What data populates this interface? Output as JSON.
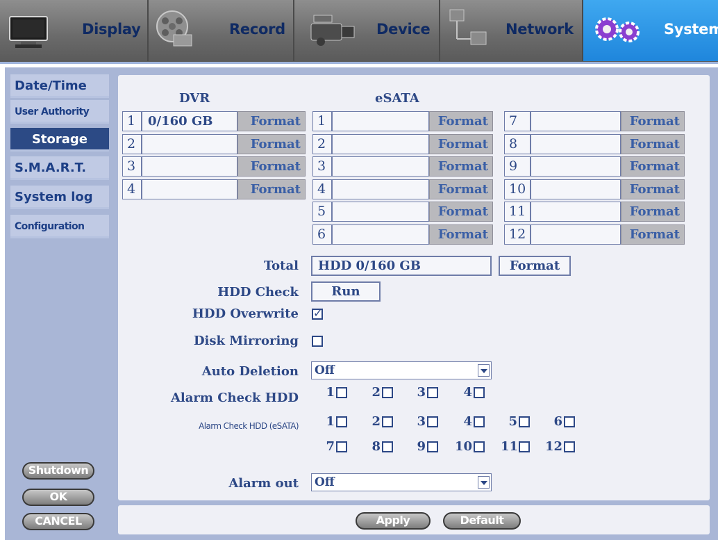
{
  "tabs": [
    {
      "label": "Display",
      "icon": "monitor-icon"
    },
    {
      "label": "Record",
      "icon": "film-reel-icon"
    },
    {
      "label": "Device",
      "icon": "camcorder-icon"
    },
    {
      "label": "Network",
      "icon": "network-icon"
    },
    {
      "label": "System",
      "icon": "gears-icon",
      "active": true
    }
  ],
  "sidebar": {
    "items": [
      {
        "label": "Date/Time"
      },
      {
        "label": "User Authority"
      },
      {
        "label": "Storage",
        "selected": true
      },
      {
        "label": "S.M.A.R.T."
      },
      {
        "label": "System log"
      },
      {
        "label": "Configuration"
      }
    ],
    "shutdown": "Shutdown",
    "ok": "OK",
    "cancel": "CANCEL"
  },
  "storage": {
    "dvr_header": "DVR",
    "esata_header": "eSATA",
    "format_label": "Format",
    "dvr": [
      {
        "num": "1",
        "value": "0/160 GB"
      },
      {
        "num": "2",
        "value": ""
      },
      {
        "num": "3",
        "value": ""
      },
      {
        "num": "4",
        "value": ""
      }
    ],
    "esata_left": [
      {
        "num": "1",
        "value": ""
      },
      {
        "num": "2",
        "value": ""
      },
      {
        "num": "3",
        "value": ""
      },
      {
        "num": "4",
        "value": ""
      },
      {
        "num": "5",
        "value": ""
      },
      {
        "num": "6",
        "value": ""
      }
    ],
    "esata_right": [
      {
        "num": "7",
        "value": ""
      },
      {
        "num": "8",
        "value": ""
      },
      {
        "num": "9",
        "value": ""
      },
      {
        "num": "10",
        "value": ""
      },
      {
        "num": "11",
        "value": ""
      },
      {
        "num": "12",
        "value": ""
      }
    ],
    "total_label": "Total",
    "total_value": "HDD 0/160 GB",
    "total_format": "Format",
    "hdd_check_label": "HDD Check",
    "hdd_check_button": "Run",
    "hdd_overwrite_label": "HDD Overwrite",
    "hdd_overwrite_checked": true,
    "disk_mirroring_label": "Disk Mirroring",
    "disk_mirroring_checked": false,
    "auto_deletion_label": "Auto Deletion",
    "auto_deletion_value": "Off",
    "alarm_check_hdd_label": "Alarm Check HDD",
    "alarm_check_hdd": [
      "1",
      "2",
      "3",
      "4"
    ],
    "alarm_check_esata_label": "Alarm Check HDD (eSATA)",
    "alarm_check_esata": [
      "1",
      "2",
      "3",
      "4",
      "5",
      "6",
      "7",
      "8",
      "9",
      "10",
      "11",
      "12"
    ],
    "alarm_out_label": "Alarm out",
    "alarm_out_value": "Off"
  },
  "footer": {
    "apply": "Apply",
    "default": "Default"
  }
}
